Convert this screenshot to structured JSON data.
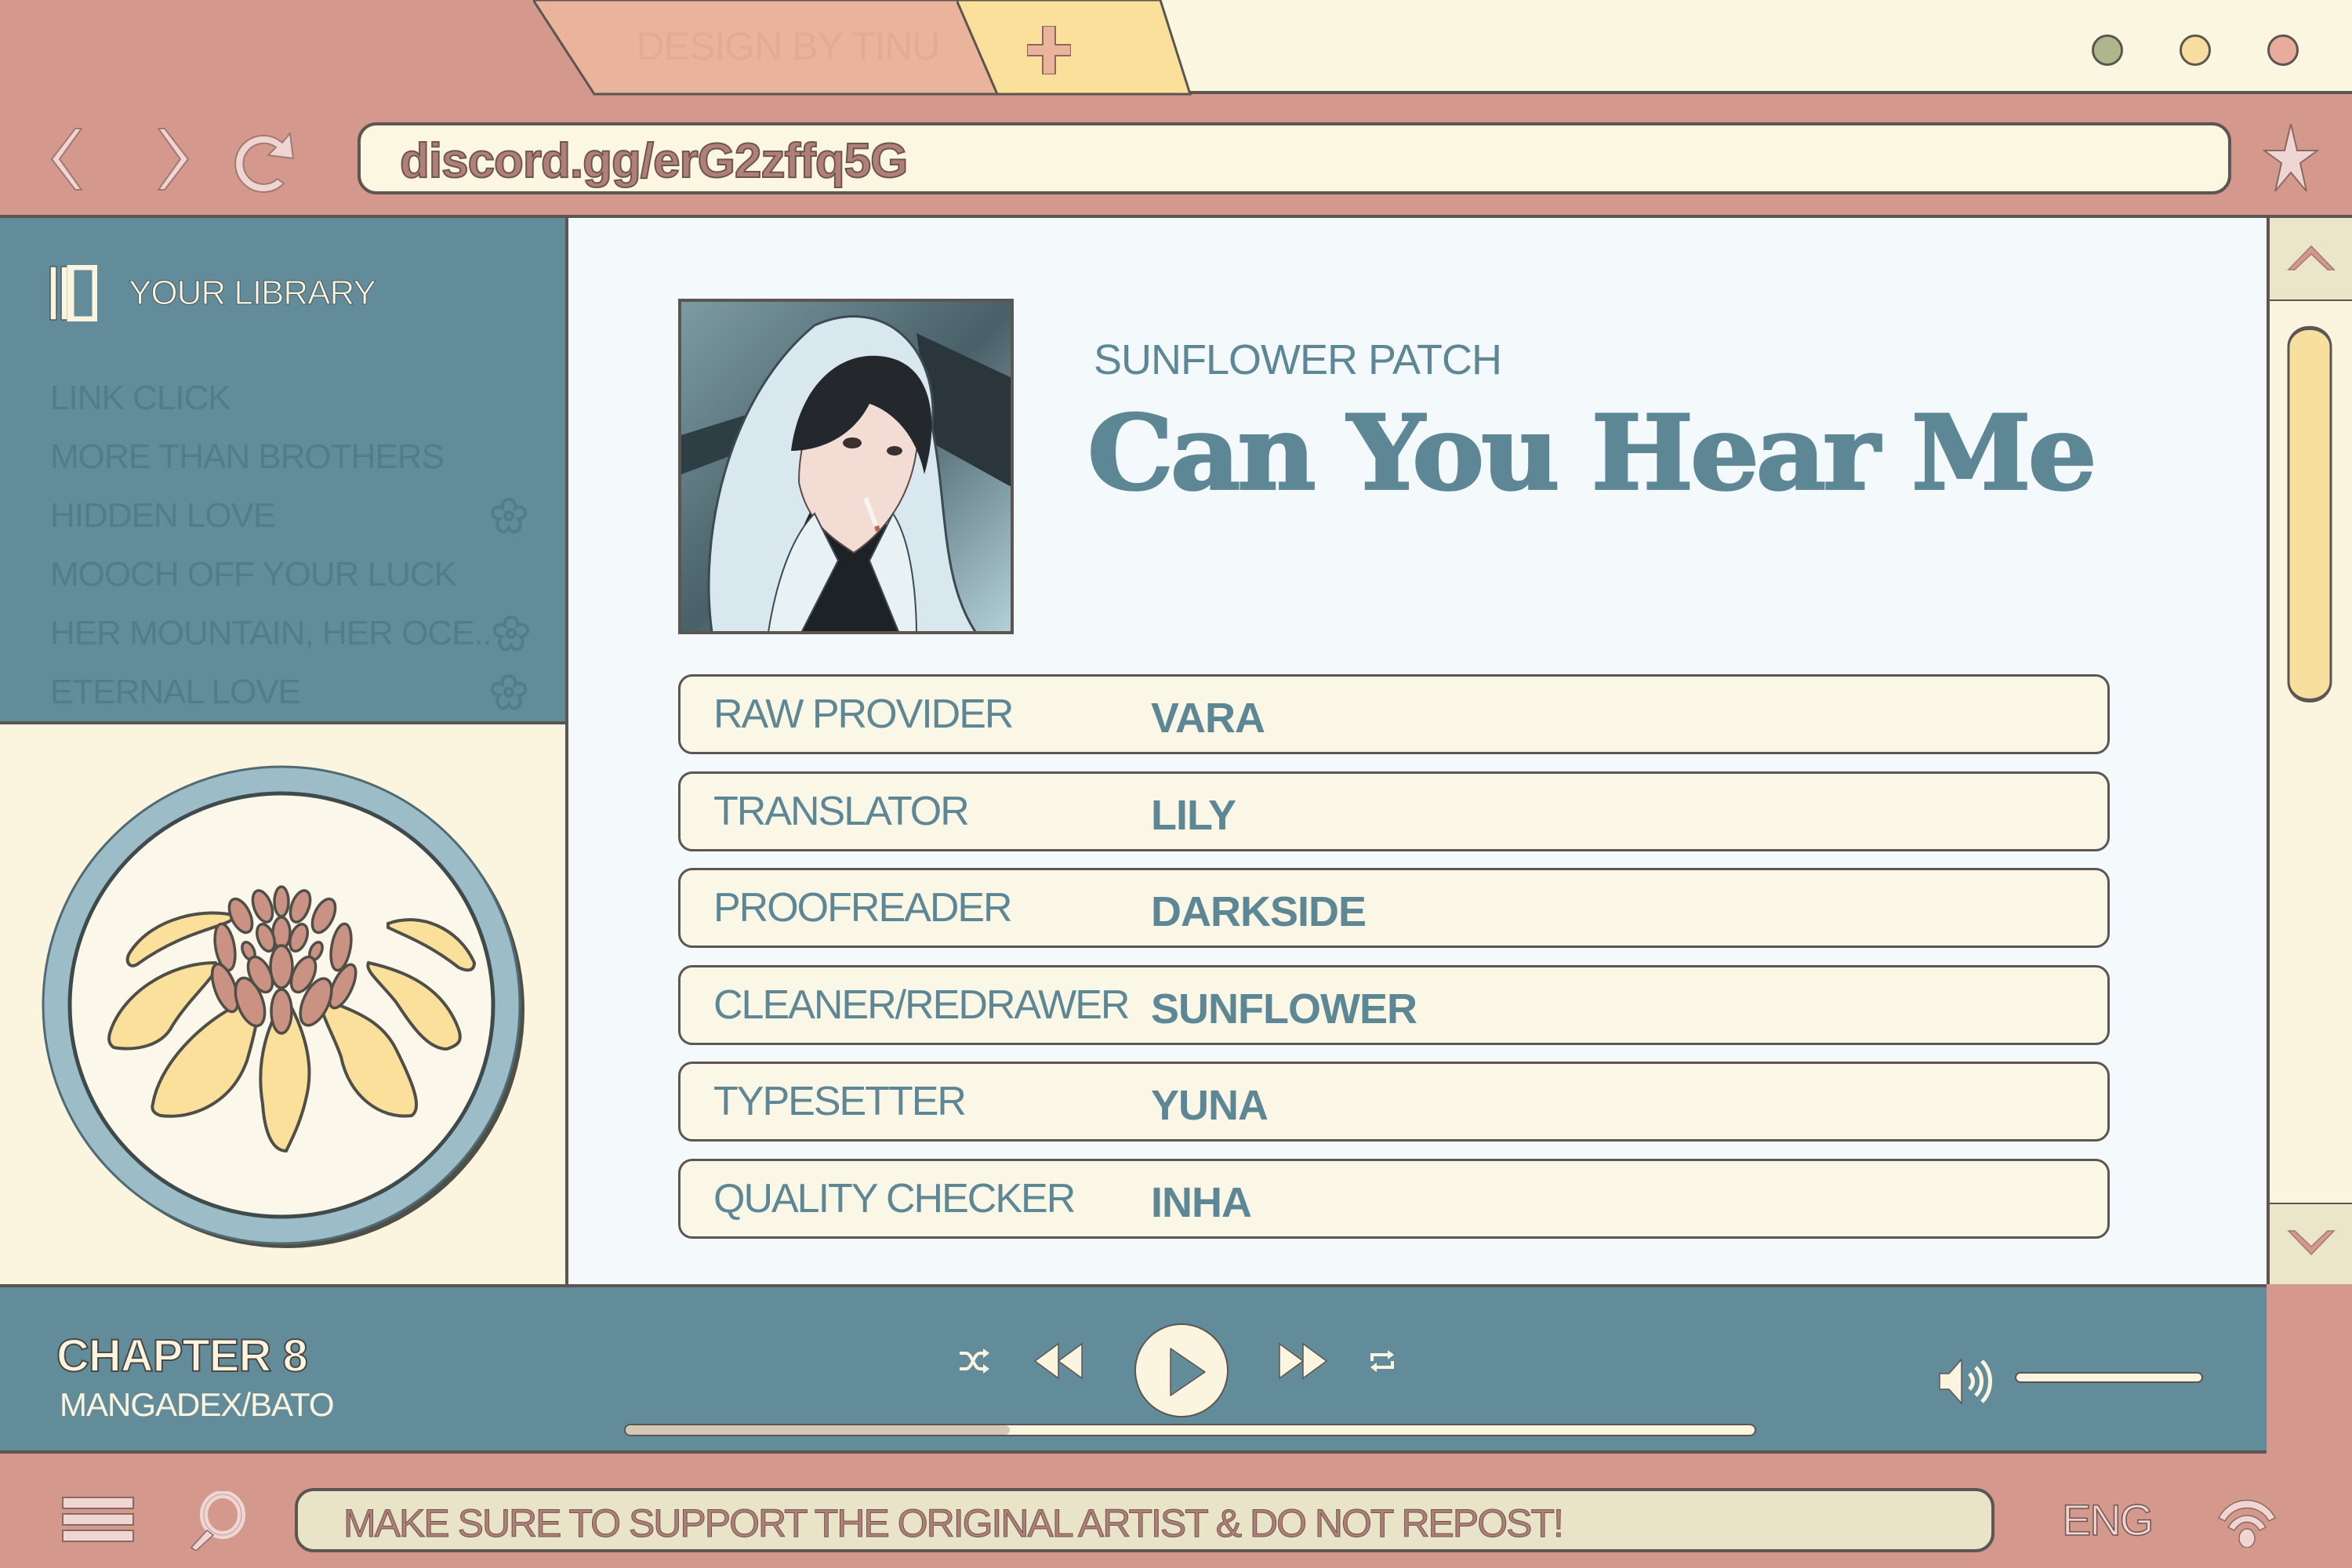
{
  "window": {
    "tab_label": "DESIGN BY TINU",
    "new_tab_icon": "plus-icon",
    "controls": [
      {
        "name": "minimize",
        "color": "#b0b68c"
      },
      {
        "name": "maximize",
        "color": "#f5dea0"
      },
      {
        "name": "close",
        "color": "#e9ab9b"
      }
    ]
  },
  "addressbar": {
    "back_icon": "chevron-left-icon",
    "forward_icon": "chevron-right-icon",
    "reload_icon": "reload-icon",
    "url": "discord.gg/erG2zffq5G",
    "bookmark_icon": "star-icon"
  },
  "sidebar": {
    "library_title": "YOUR LIBRARY",
    "library_icon": "library-icon",
    "items": [
      {
        "label": "LINK CLICK",
        "flower": false
      },
      {
        "label": "MORE THAN BROTHERS",
        "flower": false
      },
      {
        "label": "HIDDEN LOVE",
        "flower": true
      },
      {
        "label": "MOOCH OFF YOUR LUCK",
        "flower": false
      },
      {
        "label": "HER MOUNTAIN, HER OCE..",
        "flower": true
      },
      {
        "label": "ETERNAL LOVE",
        "flower": true
      }
    ]
  },
  "main": {
    "group": "SUNFLOWER PATCH",
    "title": "Can You Hear Me",
    "credits": [
      {
        "role": "RAW PROVIDER",
        "name": "VARA"
      },
      {
        "role": "TRANSLATOR",
        "name": "LILY"
      },
      {
        "role": "PROOFREADER",
        "name": "DARKSIDE"
      },
      {
        "role": "CLEANER/REDRAWER",
        "name": "SUNFLOWER"
      },
      {
        "role": "TYPESETTER",
        "name": "YUNA"
      },
      {
        "role": "QUALITY CHECKER",
        "name": "INHA"
      }
    ]
  },
  "scrollbar": {
    "position_fraction": 0.0,
    "visible_fraction": 0.38
  },
  "player": {
    "chapter": "CHAPTER 8",
    "source": "MANGADEX/BATO",
    "progress_fraction": 0.34,
    "volume_fraction": 1.0,
    "controls": [
      "shuffle-icon",
      "rewind-icon",
      "play-icon",
      "fast-forward-icon",
      "repeat-icon"
    ]
  },
  "statusbar": {
    "notice": "MAKE SURE TO SUPPORT THE ORIGINAL ARTIST & DO NOT REPOST!",
    "language": "ENG",
    "wifi_icon": "wifi-icon",
    "menu_icon": "menu-icon",
    "search_icon": "search-icon"
  },
  "colors": {
    "rose": "#d4998c",
    "cream": "#fbf5e0",
    "teal": "#638c9b",
    "teal_text": "#5e8796",
    "outline": "#5c5552",
    "yellow": "#f5dea0",
    "peach": "#e9b39c"
  }
}
